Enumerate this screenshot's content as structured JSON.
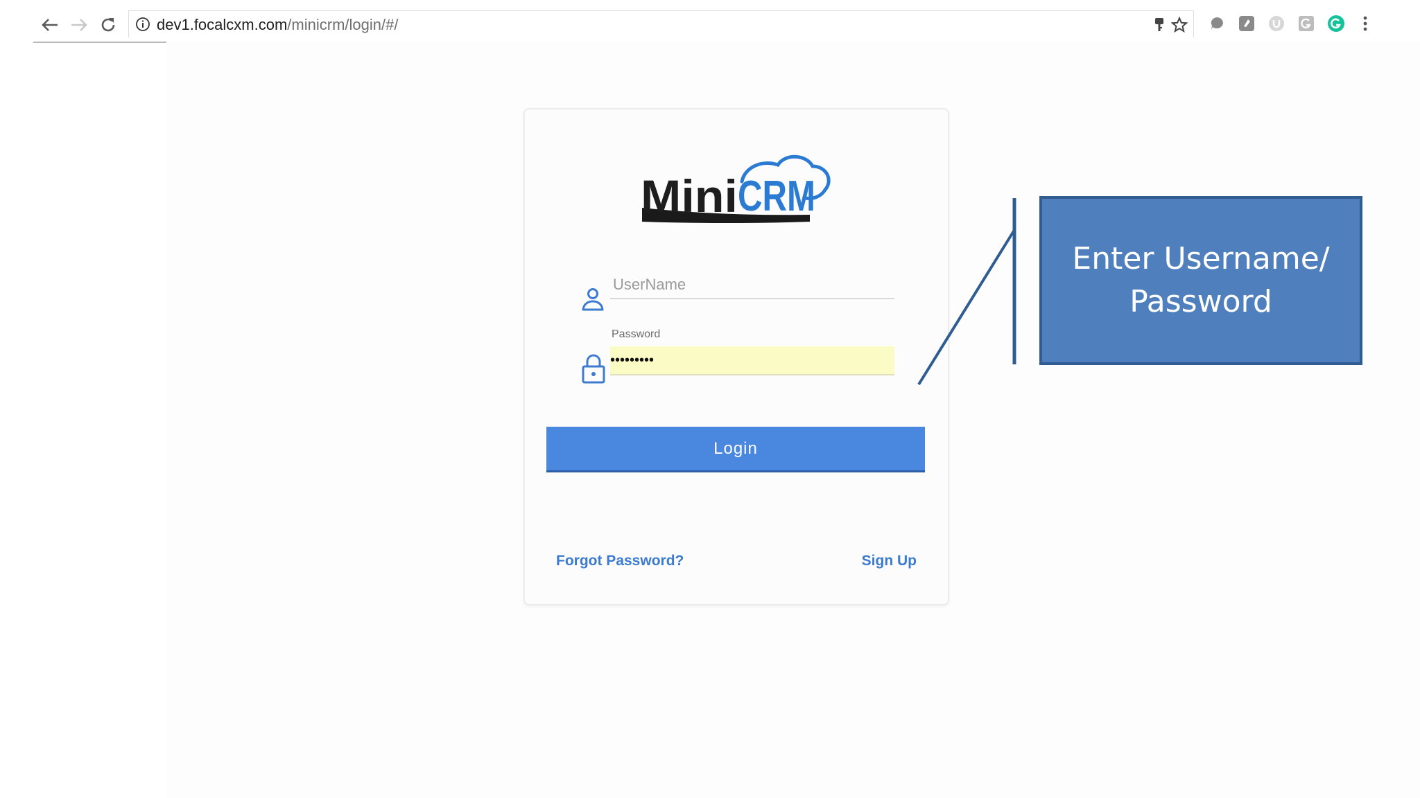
{
  "browser": {
    "url_host": "dev1.focalcxm.com",
    "url_path": "/minicrm/login/#/"
  },
  "logo": {
    "text_part1": "Mini",
    "text_part2": "CRM"
  },
  "login_form": {
    "username_placeholder": "UserName",
    "password_label": "Password",
    "password_value": "•••••••••",
    "login_button": "Login",
    "forgot_password_link": "Forgot Password?",
    "sign_up_link": "Sign Up"
  },
  "callout": {
    "line1": "Enter Username/",
    "line2": "Password"
  },
  "colors": {
    "primary": "#4a87df",
    "link": "#3c7bd0",
    "callout_fill": "#4f80bd",
    "autofill_yellow": "#fbfbc6"
  }
}
